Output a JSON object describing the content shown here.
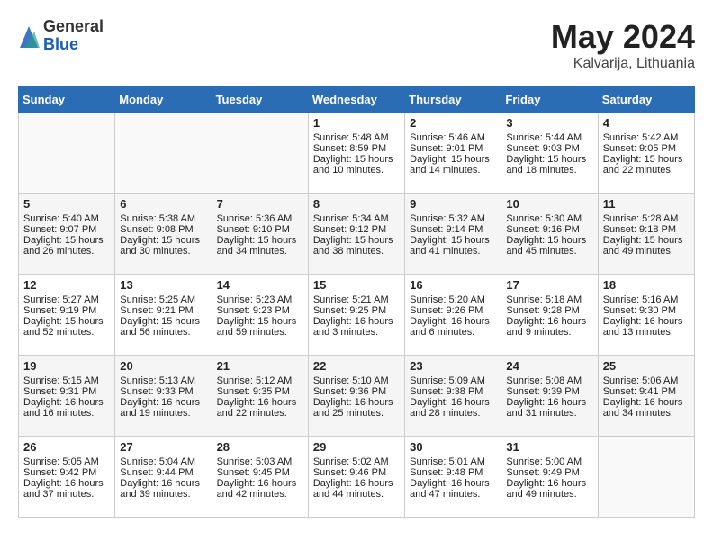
{
  "header": {
    "logo": {
      "general": "General",
      "blue": "Blue"
    },
    "title": "May 2024",
    "location": "Kalvarija, Lithuania"
  },
  "days_of_week": [
    "Sunday",
    "Monday",
    "Tuesday",
    "Wednesday",
    "Thursday",
    "Friday",
    "Saturday"
  ],
  "weeks": [
    [
      {
        "day": null
      },
      {
        "day": null
      },
      {
        "day": null
      },
      {
        "day": 1,
        "sunrise": "Sunrise: 5:48 AM",
        "sunset": "Sunset: 8:59 PM",
        "daylight": "Daylight: 15 hours and 10 minutes."
      },
      {
        "day": 2,
        "sunrise": "Sunrise: 5:46 AM",
        "sunset": "Sunset: 9:01 PM",
        "daylight": "Daylight: 15 hours and 14 minutes."
      },
      {
        "day": 3,
        "sunrise": "Sunrise: 5:44 AM",
        "sunset": "Sunset: 9:03 PM",
        "daylight": "Daylight: 15 hours and 18 minutes."
      },
      {
        "day": 4,
        "sunrise": "Sunrise: 5:42 AM",
        "sunset": "Sunset: 9:05 PM",
        "daylight": "Daylight: 15 hours and 22 minutes."
      }
    ],
    [
      {
        "day": 5,
        "sunrise": "Sunrise: 5:40 AM",
        "sunset": "Sunset: 9:07 PM",
        "daylight": "Daylight: 15 hours and 26 minutes."
      },
      {
        "day": 6,
        "sunrise": "Sunrise: 5:38 AM",
        "sunset": "Sunset: 9:08 PM",
        "daylight": "Daylight: 15 hours and 30 minutes."
      },
      {
        "day": 7,
        "sunrise": "Sunrise: 5:36 AM",
        "sunset": "Sunset: 9:10 PM",
        "daylight": "Daylight: 15 hours and 34 minutes."
      },
      {
        "day": 8,
        "sunrise": "Sunrise: 5:34 AM",
        "sunset": "Sunset: 9:12 PM",
        "daylight": "Daylight: 15 hours and 38 minutes."
      },
      {
        "day": 9,
        "sunrise": "Sunrise: 5:32 AM",
        "sunset": "Sunset: 9:14 PM",
        "daylight": "Daylight: 15 hours and 41 minutes."
      },
      {
        "day": 10,
        "sunrise": "Sunrise: 5:30 AM",
        "sunset": "Sunset: 9:16 PM",
        "daylight": "Daylight: 15 hours and 45 minutes."
      },
      {
        "day": 11,
        "sunrise": "Sunrise: 5:28 AM",
        "sunset": "Sunset: 9:18 PM",
        "daylight": "Daylight: 15 hours and 49 minutes."
      }
    ],
    [
      {
        "day": 12,
        "sunrise": "Sunrise: 5:27 AM",
        "sunset": "Sunset: 9:19 PM",
        "daylight": "Daylight: 15 hours and 52 minutes."
      },
      {
        "day": 13,
        "sunrise": "Sunrise: 5:25 AM",
        "sunset": "Sunset: 9:21 PM",
        "daylight": "Daylight: 15 hours and 56 minutes."
      },
      {
        "day": 14,
        "sunrise": "Sunrise: 5:23 AM",
        "sunset": "Sunset: 9:23 PM",
        "daylight": "Daylight: 15 hours and 59 minutes."
      },
      {
        "day": 15,
        "sunrise": "Sunrise: 5:21 AM",
        "sunset": "Sunset: 9:25 PM",
        "daylight": "Daylight: 16 hours and 3 minutes."
      },
      {
        "day": 16,
        "sunrise": "Sunrise: 5:20 AM",
        "sunset": "Sunset: 9:26 PM",
        "daylight": "Daylight: 16 hours and 6 minutes."
      },
      {
        "day": 17,
        "sunrise": "Sunrise: 5:18 AM",
        "sunset": "Sunset: 9:28 PM",
        "daylight": "Daylight: 16 hours and 9 minutes."
      },
      {
        "day": 18,
        "sunrise": "Sunrise: 5:16 AM",
        "sunset": "Sunset: 9:30 PM",
        "daylight": "Daylight: 16 hours and 13 minutes."
      }
    ],
    [
      {
        "day": 19,
        "sunrise": "Sunrise: 5:15 AM",
        "sunset": "Sunset: 9:31 PM",
        "daylight": "Daylight: 16 hours and 16 minutes."
      },
      {
        "day": 20,
        "sunrise": "Sunrise: 5:13 AM",
        "sunset": "Sunset: 9:33 PM",
        "daylight": "Daylight: 16 hours and 19 minutes."
      },
      {
        "day": 21,
        "sunrise": "Sunrise: 5:12 AM",
        "sunset": "Sunset: 9:35 PM",
        "daylight": "Daylight: 16 hours and 22 minutes."
      },
      {
        "day": 22,
        "sunrise": "Sunrise: 5:10 AM",
        "sunset": "Sunset: 9:36 PM",
        "daylight": "Daylight: 16 hours and 25 minutes."
      },
      {
        "day": 23,
        "sunrise": "Sunrise: 5:09 AM",
        "sunset": "Sunset: 9:38 PM",
        "daylight": "Daylight: 16 hours and 28 minutes."
      },
      {
        "day": 24,
        "sunrise": "Sunrise: 5:08 AM",
        "sunset": "Sunset: 9:39 PM",
        "daylight": "Daylight: 16 hours and 31 minutes."
      },
      {
        "day": 25,
        "sunrise": "Sunrise: 5:06 AM",
        "sunset": "Sunset: 9:41 PM",
        "daylight": "Daylight: 16 hours and 34 minutes."
      }
    ],
    [
      {
        "day": 26,
        "sunrise": "Sunrise: 5:05 AM",
        "sunset": "Sunset: 9:42 PM",
        "daylight": "Daylight: 16 hours and 37 minutes."
      },
      {
        "day": 27,
        "sunrise": "Sunrise: 5:04 AM",
        "sunset": "Sunset: 9:44 PM",
        "daylight": "Daylight: 16 hours and 39 minutes."
      },
      {
        "day": 28,
        "sunrise": "Sunrise: 5:03 AM",
        "sunset": "Sunset: 9:45 PM",
        "daylight": "Daylight: 16 hours and 42 minutes."
      },
      {
        "day": 29,
        "sunrise": "Sunrise: 5:02 AM",
        "sunset": "Sunset: 9:46 PM",
        "daylight": "Daylight: 16 hours and 44 minutes."
      },
      {
        "day": 30,
        "sunrise": "Sunrise: 5:01 AM",
        "sunset": "Sunset: 9:48 PM",
        "daylight": "Daylight: 16 hours and 47 minutes."
      },
      {
        "day": 31,
        "sunrise": "Sunrise: 5:00 AM",
        "sunset": "Sunset: 9:49 PM",
        "daylight": "Daylight: 16 hours and 49 minutes."
      },
      {
        "day": null
      }
    ]
  ]
}
